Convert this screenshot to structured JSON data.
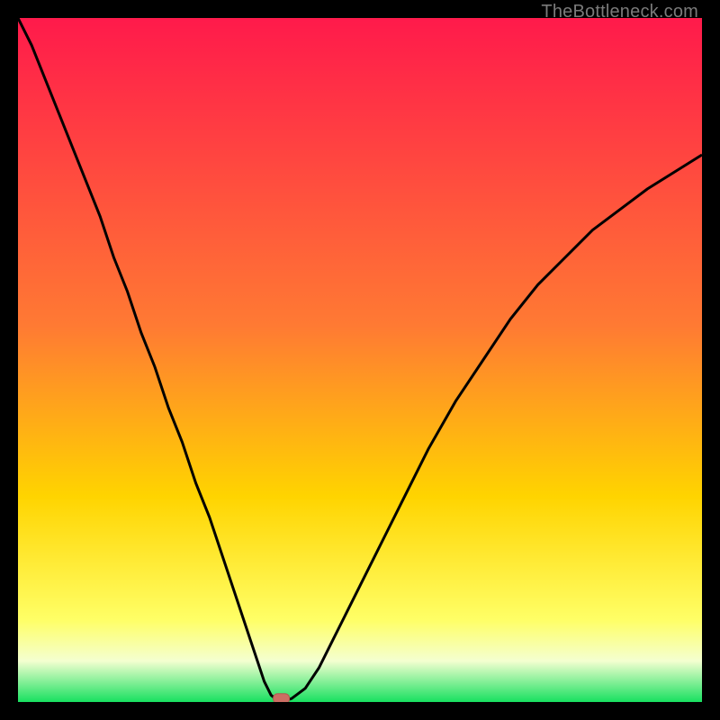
{
  "watermark": "TheBottleneck.com",
  "colors": {
    "frame": "#000000",
    "curve": "#000000",
    "marker_fill": "#cc6e63",
    "marker_stroke": "#b35a50",
    "grad_top": "#ff1a4b",
    "grad_mid1": "#ff7a33",
    "grad_mid2": "#ffd400",
    "grad_low1": "#ffff66",
    "grad_low2": "#f4ffd0",
    "grad_bottom": "#18e060"
  },
  "chart_data": {
    "type": "line",
    "title": "",
    "xlabel": "",
    "ylabel": "",
    "xlim": [
      0,
      100
    ],
    "ylim": [
      0,
      100
    ],
    "x": [
      0,
      2,
      4,
      6,
      8,
      10,
      12,
      14,
      16,
      18,
      20,
      22,
      24,
      26,
      28,
      30,
      32,
      34,
      35,
      36,
      37,
      38,
      39,
      40,
      42,
      44,
      46,
      48,
      50,
      52,
      54,
      56,
      58,
      60,
      64,
      68,
      72,
      76,
      80,
      84,
      88,
      92,
      96,
      100
    ],
    "values": [
      100,
      96,
      91,
      86,
      81,
      76,
      71,
      65,
      60,
      54,
      49,
      43,
      38,
      32,
      27,
      21,
      15,
      9,
      6,
      3,
      1,
      0.2,
      0.2,
      0.5,
      2,
      5,
      9,
      13,
      17,
      21,
      25,
      29,
      33,
      37,
      44,
      50,
      56,
      61,
      65,
      69,
      72,
      75,
      77.5,
      80
    ],
    "marker": {
      "x": 38.5,
      "y": 0.5
    },
    "gradient_stops": [
      {
        "pct": 0,
        "value": 100
      },
      {
        "pct": 45,
        "value": 55
      },
      {
        "pct": 70,
        "value": 30
      },
      {
        "pct": 88,
        "value": 12
      },
      {
        "pct": 94,
        "value": 6
      },
      {
        "pct": 100,
        "value": 0
      }
    ]
  }
}
